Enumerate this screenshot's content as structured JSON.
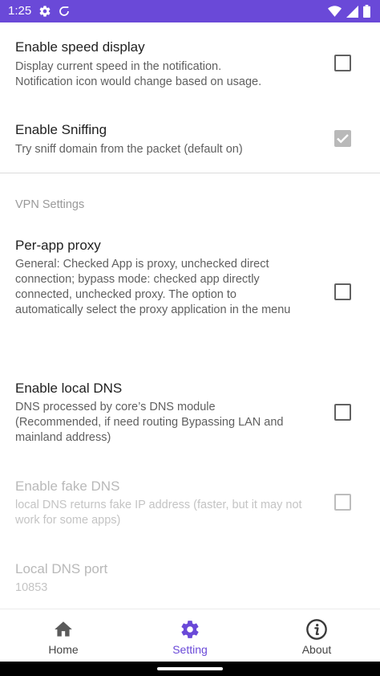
{
  "status_bar": {
    "time": "1:25",
    "left_icons": [
      "settings-icon",
      "vpn-sigma-icon"
    ],
    "right_icons": [
      "wifi-icon",
      "signal-icon",
      "battery-icon"
    ],
    "color": "#6a49d8"
  },
  "prefs": {
    "speed_display": {
      "title": "Enable speed display",
      "summary": "Display current speed in the notification.\nNotification icon would change based on usage.",
      "checked": false
    },
    "sniffing": {
      "title": "Enable Sniffing",
      "summary": "Try sniff domain from the packet (default on)",
      "checked": true,
      "disabled": true
    },
    "vpn_section_header": "VPN Settings",
    "per_app_proxy": {
      "title": "Per-app proxy",
      "summary": "General: Checked App is proxy, unchecked direct connection;\nbypass mode: checked app directly connected, unchecked proxy.\nThe option to automatically select the proxy application in the menu",
      "checked": false
    },
    "local_dns": {
      "title": "Enable local DNS",
      "summary": "DNS processed by core’s DNS module (Recommended, if need routing Bypassing LAN and mainland address)",
      "checked": false
    },
    "fake_dns": {
      "title": "Enable fake DNS",
      "summary": "local DNS returns fake IP address (faster, but it may not work for some apps)",
      "checked": false,
      "disabled": true
    },
    "local_dns_port": {
      "title": "Local DNS port",
      "summary": "10853",
      "disabled": true
    }
  },
  "bottom_nav": {
    "items": [
      {
        "label": "Home",
        "icon": "home-icon"
      },
      {
        "label": "Setting",
        "icon": "gear-icon",
        "active": true
      },
      {
        "label": "About",
        "icon": "info-icon"
      }
    ],
    "active_color": "#6a49d8"
  }
}
